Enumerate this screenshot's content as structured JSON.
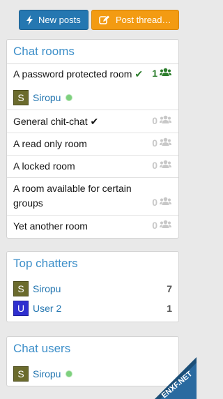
{
  "buttons": {
    "new_posts": "New posts",
    "post_thread": "Post thread…"
  },
  "chat_rooms": {
    "title": "Chat rooms",
    "rooms": [
      {
        "name": "A password protected room",
        "check": "✔",
        "count": "1",
        "active": true
      },
      {
        "name": "General chit-chat",
        "check": "✔",
        "count": "0",
        "active": false
      },
      {
        "name": "A read only room",
        "check": "",
        "count": "0",
        "active": false
      },
      {
        "name": "A locked room",
        "check": "",
        "count": "0",
        "active": false
      },
      {
        "name": "A room available for certain groups",
        "check": "",
        "count": "0",
        "active": false
      },
      {
        "name": "Yet another room",
        "check": "",
        "count": "0",
        "active": false
      }
    ],
    "room_user": {
      "avatar_letter": "S",
      "name": "Siropu"
    }
  },
  "top_chatters": {
    "title": "Top chatters",
    "users": [
      {
        "avatar_letter": "S",
        "name": "Siropu",
        "count": "7"
      },
      {
        "avatar_letter": "U",
        "name": "User 2",
        "count": "1"
      }
    ]
  },
  "chat_users": {
    "title": "Chat users",
    "users": [
      {
        "avatar_letter": "S",
        "name": "Siropu"
      }
    ]
  },
  "watermark": "ENXF.NET",
  "colors": {
    "primary": "#2577b1",
    "accent": "#f39b12",
    "title": "#3d8fc9",
    "active_green": "#2c7d2c",
    "online": "#7ed07e"
  },
  "icons": {
    "new_posts": "bolt-icon",
    "post_thread": "edit-icon",
    "room_users": "users-icon",
    "online": "online-dot-icon"
  }
}
